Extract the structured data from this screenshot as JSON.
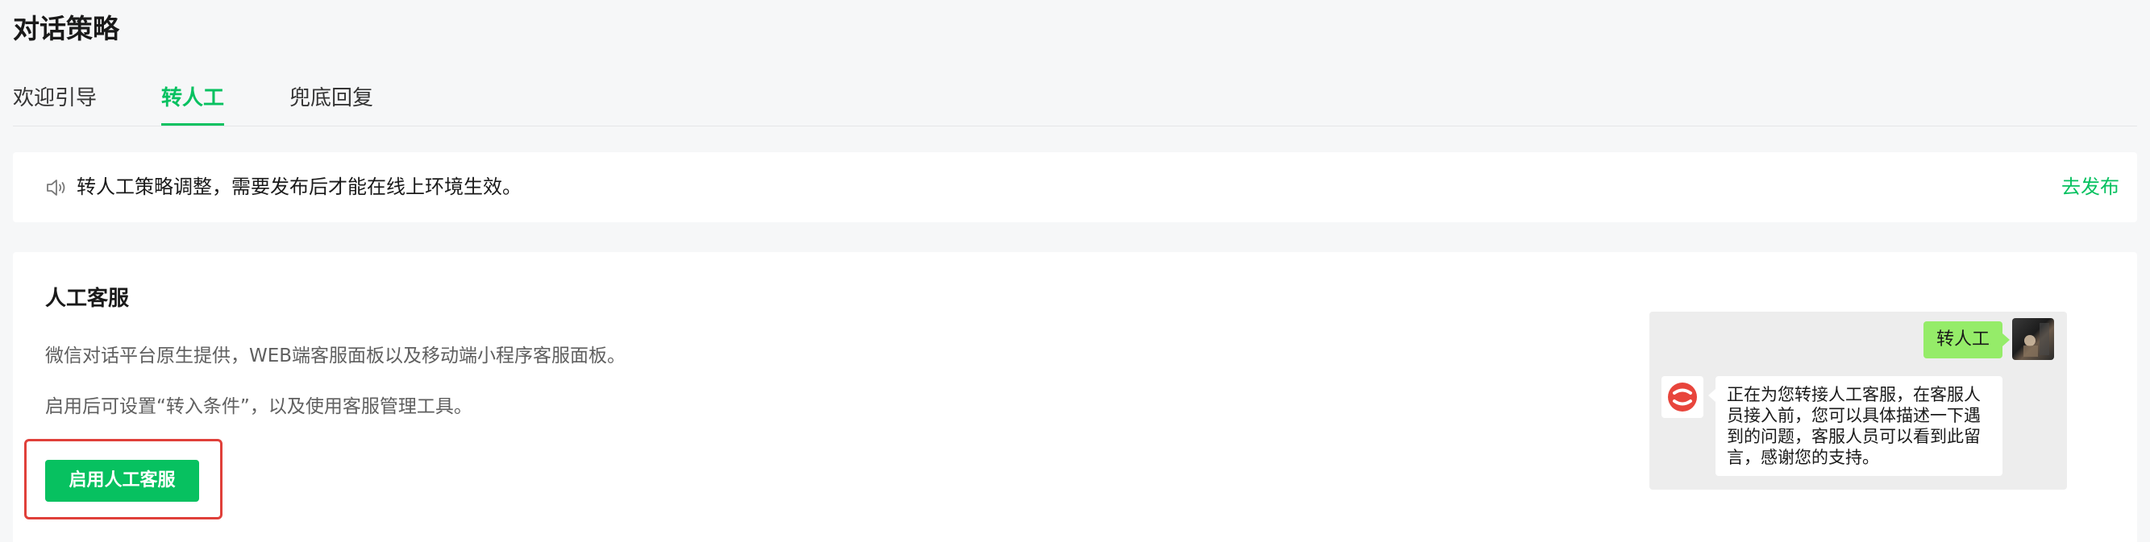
{
  "page_title": "对话策略",
  "tabs": [
    {
      "label": "欢迎引导",
      "active": false
    },
    {
      "label": "转人工",
      "active": true
    },
    {
      "label": "兜底回复",
      "active": false
    }
  ],
  "notice": {
    "icon": "speaker-icon",
    "text": "转人工策略调整，需要发布后才能在线上环境生效。",
    "link_label": "去发布"
  },
  "card": {
    "title": "人工客服",
    "desc1": "微信对话平台原生提供，WEB端客服面板以及移动端小程序客服面板。",
    "desc2": "启用后可设置“转入条件”，以及使用客服管理工具。",
    "button_label": "启用人工客服"
  },
  "preview": {
    "user_message": "转人工",
    "bot_message": "正在为您转接人工客服，在客服人员接入前，您可以具体描述一下遇到的问题，客服人员可以看到此留言，感谢您的支持。"
  },
  "colors": {
    "accent": "#07c160",
    "highlight_border": "#e0403a",
    "user_bubble": "#95ec69",
    "bot_logo": "#e8453c"
  }
}
